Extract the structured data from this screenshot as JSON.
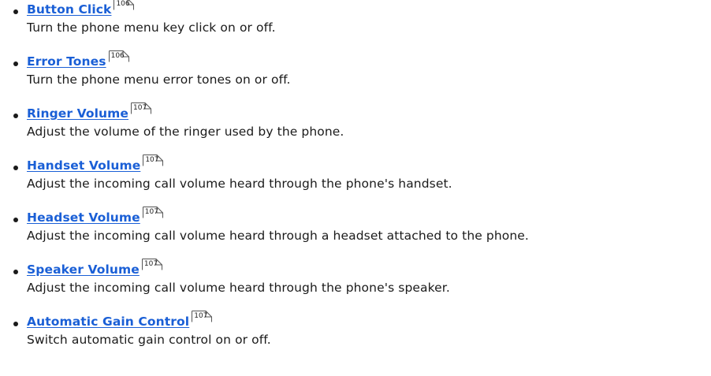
{
  "items": [
    {
      "title": "Button Click",
      "page": "106",
      "desc": "Turn the phone menu key click on or off."
    },
    {
      "title": "Error Tones",
      "page": "106",
      "desc": "Turn the phone menu error tones on or off."
    },
    {
      "title": "Ringer Volume",
      "page": "107",
      "desc": "Adjust the volume of the ringer used by the phone."
    },
    {
      "title": "Handset Volume",
      "page": "107",
      "desc": "Adjust the incoming call volume heard through the phone's handset."
    },
    {
      "title": "Headset Volume",
      "page": "107",
      "desc": "Adjust the incoming call volume heard through a headset attached to the phone."
    },
    {
      "title": "Speaker Volume",
      "page": "107",
      "desc": "Adjust the incoming call volume heard through the phone's speaker."
    },
    {
      "title": "Automatic Gain Control",
      "page": "107",
      "desc": "Switch automatic gain control on or off."
    }
  ]
}
